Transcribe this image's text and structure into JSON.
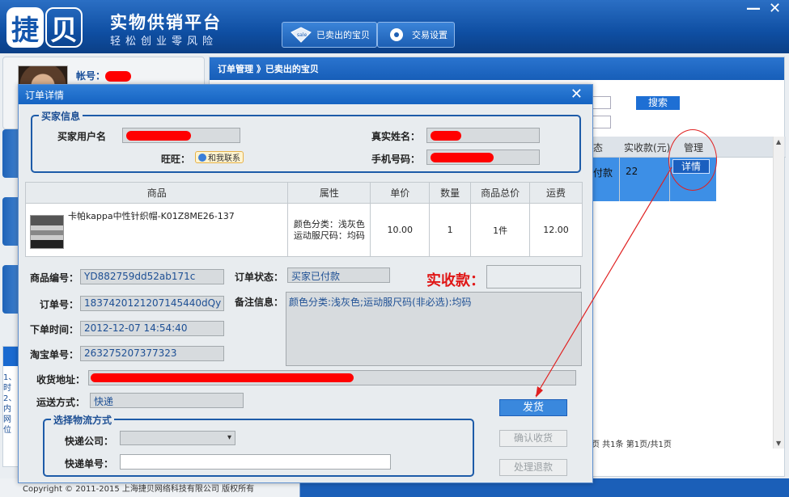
{
  "app": {
    "logo_char1": "捷",
    "logo_char2": "贝",
    "title": "实物供销平台",
    "slogan": "轻松创业零风险",
    "top_buttons": [
      {
        "label": "已卖出的宝贝",
        "icon": "sale-tag-icon"
      },
      {
        "label": "交易设置",
        "icon": "settings-gear-icon"
      }
    ],
    "window_controls": {
      "minimize": "—",
      "close": "✕"
    }
  },
  "left": {
    "account_label": "帐号：",
    "notice_lines": [
      "1、",
      "时",
      "",
      "2、",
      "内",
      "网",
      "位"
    ]
  },
  "main": {
    "breadcrumb": "订单管理 》已卖出的宝贝",
    "search_button": "搜索",
    "grid_headers": [
      "态",
      "实收款(元)",
      "管理"
    ],
    "grid_row": {
      "status": "付款",
      "received": "22",
      "action": "详情"
    },
    "pager": "页  共1条 第1页/共1页"
  },
  "footer": {
    "copyright": "Copyright © 2011-2015 上海捷贝网络科技有限公司 版权所有"
  },
  "modal": {
    "title": "订单详情",
    "close": "✕",
    "buyer_section": {
      "legend": "买家信息",
      "username_label": "买家用户名",
      "realname_label": "真实姓名：",
      "wangwang_label": "旺旺：",
      "wangwang_button": "和我联系",
      "phone_label": "手机号码："
    },
    "product_table": {
      "headers": [
        "商品",
        "属性",
        "单价",
        "数量",
        "商品总价",
        "运费"
      ],
      "row": {
        "name": "卡帕kappa中性针织帽-K01Z8ME26-137",
        "attr_line1": "颜色分类：浅灰色",
        "attr_line2": "运动服尺码：均码",
        "price": "10.00",
        "quantity": "1",
        "total": "1件",
        "shipping": "12.00"
      }
    },
    "order": {
      "product_code_label": "商品编号：",
      "product_code": "YD882759dd52ab171c",
      "order_no_label": "订单号：",
      "order_no": "1837420121207145440dQy",
      "order_time_label": "下单时间：",
      "order_time": "2012-12-07 14:54:40",
      "taobao_no_label": "淘宝单号：",
      "taobao_no": "263275207377323",
      "status_label": "订单状态：",
      "status": "买家已付款",
      "net_received_label": "实收款：",
      "memo_label": "备注信息：",
      "memo": "颜色分类:浅灰色;运动服尺码(非必选):均码",
      "address_label": "收货地址：",
      "shipping_method_label": "运送方式：",
      "shipping_method": "快递"
    },
    "logistics": {
      "legend": "选择物流方式",
      "company_label": "快递公司：",
      "tracking_label": "快递单号：",
      "company_selected": "▾"
    },
    "buttons": {
      "ship": "发货",
      "confirm_receipt": "确认收货",
      "refund": "处理退款"
    }
  },
  "colors": {
    "accent": "#1563c2",
    "alert_red": "#e01616",
    "redaction": "#ff0000"
  }
}
